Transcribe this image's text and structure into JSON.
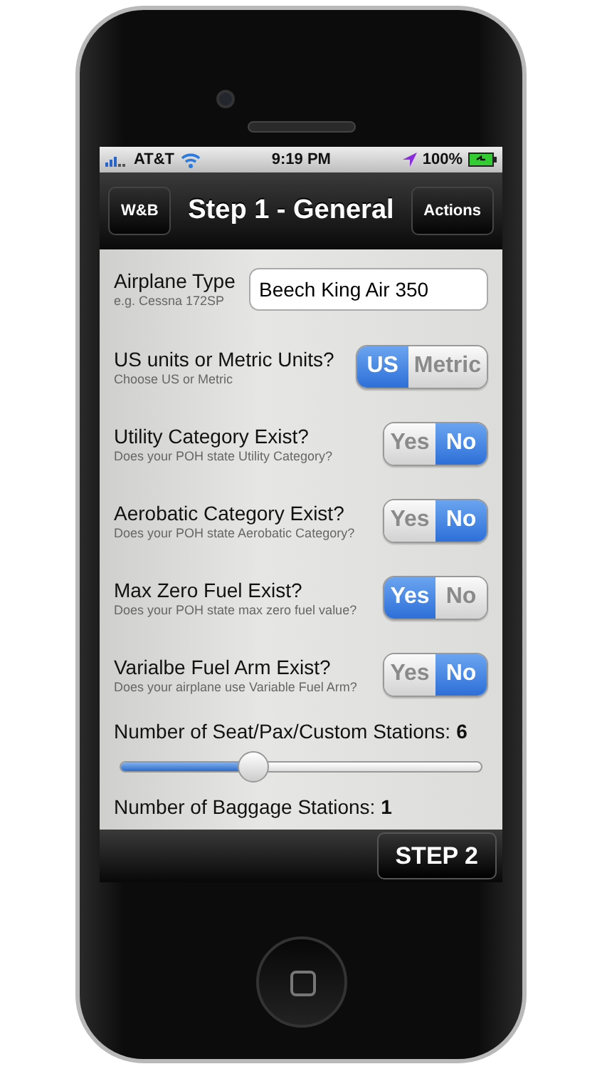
{
  "status_bar": {
    "carrier": "AT&T",
    "time": "9:19 PM",
    "battery": "100%"
  },
  "nav_bar": {
    "back_button": "W&B",
    "title": "Step 1 - General",
    "action_button": "Actions"
  },
  "rows": [
    {
      "kind": "text",
      "label": "Airplane Type",
      "hint": "e.g. Cessna 172SP",
      "value": "Beech King Air 350"
    },
    {
      "kind": "segmented",
      "label": "US units or Metric Units?",
      "hint": "Choose US or Metric",
      "options": [
        {
          "label": "US",
          "selected": true
        },
        {
          "label": "Metric",
          "selected": false
        }
      ]
    },
    {
      "kind": "segmented",
      "label": "Utility Category Exist?",
      "hint": "Does your POH state Utility Category?",
      "options": [
        {
          "label": "Yes",
          "selected": false
        },
        {
          "label": "No",
          "selected": true
        }
      ]
    },
    {
      "kind": "segmented",
      "label": "Aerobatic Category Exist?",
      "hint": "Does your POH state Aerobatic Category?",
      "options": [
        {
          "label": "Yes",
          "selected": false
        },
        {
          "label": "No",
          "selected": true
        }
      ]
    },
    {
      "kind": "segmented",
      "label": "Max Zero Fuel Exist?",
      "hint": "Does your POH state max zero fuel value?",
      "options": [
        {
          "label": "Yes",
          "selected": true
        },
        {
          "label": "No",
          "selected": false
        }
      ]
    },
    {
      "kind": "segmented",
      "label": "Varialbe Fuel Arm Exist?",
      "hint": "Does your airplane use Variable Fuel Arm?",
      "options": [
        {
          "label": "Yes",
          "selected": false
        },
        {
          "label": "No",
          "selected": true
        }
      ]
    },
    {
      "kind": "slider",
      "label": "Number of Seat/Pax/Custom Stations:",
      "value": "6",
      "level": 0.37
    },
    {
      "kind": "heading",
      "label": "Number of Baggage Stations:",
      "value": "1"
    }
  ],
  "toolbar": {
    "next_button": "STEP 2"
  }
}
